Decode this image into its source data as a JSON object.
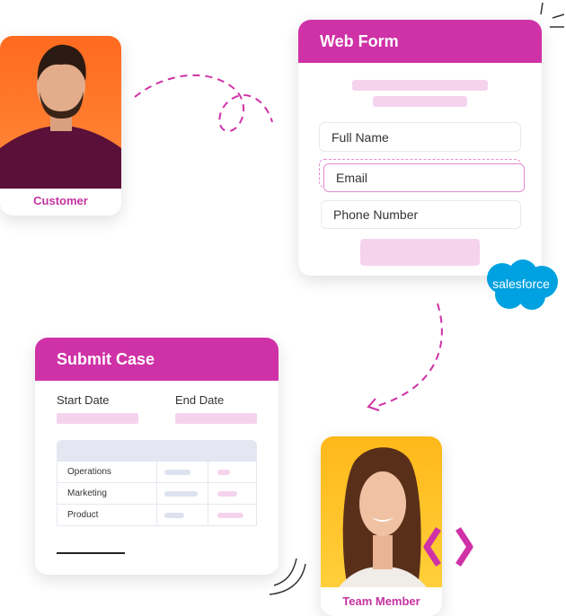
{
  "customer": {
    "label": "Customer",
    "photo_bg": "#ff7a2a"
  },
  "web_form": {
    "title": "Web Form",
    "fields": [
      {
        "placeholder": "Full Name"
      },
      {
        "placeholder": "Email"
      },
      {
        "placeholder": "Phone Number"
      }
    ]
  },
  "salesforce": {
    "logo_text": "salesforce",
    "color": "#00a1e0"
  },
  "submit_case": {
    "title": "Submit Case",
    "start_label": "Start Date",
    "end_label": "End Date",
    "rows": [
      "Operations",
      "Marketing",
      "Product"
    ]
  },
  "team_member": {
    "label": "Team Member",
    "photo_bg": "#ffc21f"
  },
  "colors": {
    "accent": "#cf31a7",
    "pink_light": "#f5d3ed"
  }
}
